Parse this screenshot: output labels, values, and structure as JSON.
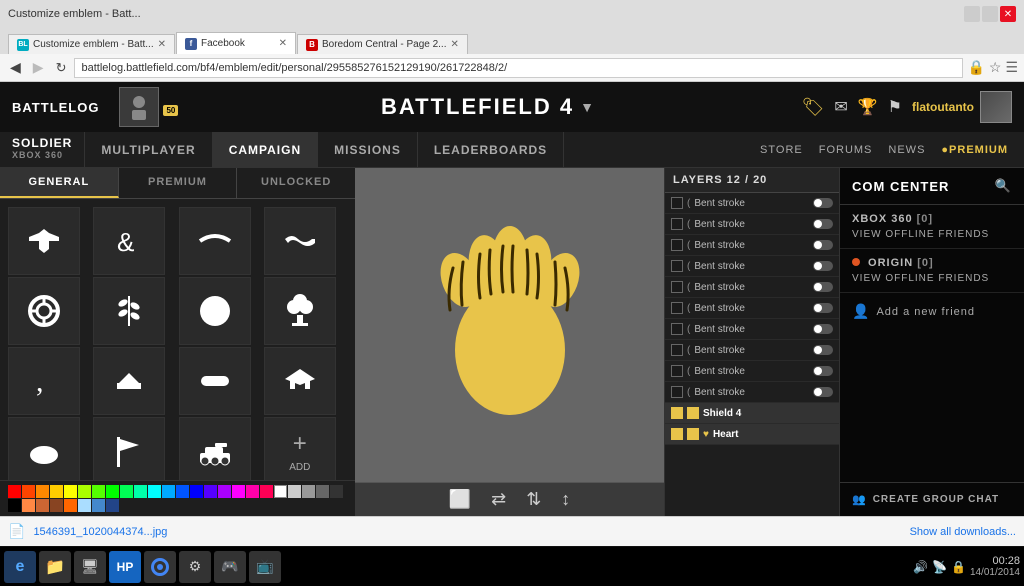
{
  "browser": {
    "tabs": [
      {
        "id": "bl",
        "label": "Customize emblem - Batt...",
        "icon": "BL",
        "active": false
      },
      {
        "id": "fb",
        "label": "Facebook",
        "icon": "f",
        "active": true
      },
      {
        "id": "bc",
        "label": "Boredom Central - Page 2...",
        "icon": "B",
        "active": false
      }
    ],
    "address": "battlelog.battlefield.com/bf4/emblem/edit/personal/295585276152129190/261722848/2/"
  },
  "app": {
    "logo": "BATTLELOG",
    "game_title": "BATTLEFIELD 4",
    "username": "flatoutanto"
  },
  "subnav": {
    "items": [
      {
        "id": "soldier",
        "label": "SOLDIER",
        "platform": "XBOX 360"
      },
      {
        "id": "multiplayer",
        "label": "MULTIPLAYER"
      },
      {
        "id": "campaign",
        "label": "CAMPAIGN"
      },
      {
        "id": "missions",
        "label": "MISSIONS"
      },
      {
        "id": "leaderboards",
        "label": "LEADERBOARDS"
      }
    ],
    "right_items": [
      {
        "id": "store",
        "label": "STORE"
      },
      {
        "id": "forums",
        "label": "FORUMS"
      },
      {
        "id": "news",
        "label": "NEWS"
      },
      {
        "id": "premium",
        "label": "PREMIUM"
      }
    ]
  },
  "shapes_tabs": [
    {
      "id": "general",
      "label": "GENERAL",
      "active": true
    },
    {
      "id": "premium",
      "label": "PREMIUM"
    },
    {
      "id": "unlocked",
      "label": "UNLOCKED"
    }
  ],
  "layers": {
    "header": "LAYERS 12 / 20",
    "items": [
      {
        "name": "Bent stroke",
        "color": "#555",
        "active": false,
        "toggle": true
      },
      {
        "name": "Bent stroke",
        "color": "#555",
        "active": false,
        "toggle": true
      },
      {
        "name": "Bent stroke",
        "color": "#555",
        "active": false,
        "toggle": true
      },
      {
        "name": "Bent stroke",
        "color": "#555",
        "active": false,
        "toggle": true
      },
      {
        "name": "Bent stroke",
        "color": "#555",
        "active": false,
        "toggle": true
      },
      {
        "name": "Bent stroke",
        "color": "#555",
        "active": false,
        "toggle": true
      },
      {
        "name": "Bent stroke",
        "color": "#555",
        "active": false,
        "toggle": true
      },
      {
        "name": "Bent stroke",
        "color": "#555",
        "active": false,
        "toggle": true
      },
      {
        "name": "Bent stroke",
        "color": "#555",
        "active": false,
        "toggle": true
      },
      {
        "name": "Bent stroke",
        "color": "#555",
        "active": false,
        "toggle": true
      },
      {
        "name": "Shield 4",
        "color": "#e8c44a",
        "active": true,
        "toggle": false
      },
      {
        "name": "Heart",
        "color": "#e8c44a",
        "active": true,
        "toggle": false
      }
    ]
  },
  "com_center": {
    "title": "COM CENTER",
    "platforms": [
      {
        "name": "XBOX 360",
        "count": "[0]",
        "has_indicator": false
      },
      {
        "name": "VIEW OFFLINE FRIENDS",
        "count": "",
        "is_link": true
      },
      {
        "name": "ORIGIN",
        "count": "[0]",
        "has_indicator": true
      },
      {
        "name": "VIEW OFFLINE FRIENDS",
        "count": "",
        "is_link": true
      }
    ],
    "add_friend": "Add a new friend",
    "create_group": "CREATE GROUP CHAT"
  },
  "download_bar": {
    "filename": "1546391_1020044374...jpg",
    "action": "Show all downloads..."
  },
  "taskbar": {
    "time": "00:28",
    "date": "14/01/2014"
  },
  "palette_colors": [
    "#ff0000",
    "#ff4400",
    "#ff8800",
    "#ffcc00",
    "#ffff00",
    "#ccff00",
    "#88ff00",
    "#44ff00",
    "#00ff00",
    "#00ff44",
    "#00ff88",
    "#00ffcc",
    "#00ffff",
    "#00ccff",
    "#0088ff",
    "#0044ff",
    "#0000ff",
    "#4400ff",
    "#8800ff",
    "#cc00ff",
    "#ff00ff",
    "#ff00cc",
    "#ff0088",
    "#ff0044",
    "#ff0000",
    "#ffffff",
    "#cccccc",
    "#999999",
    "#666666",
    "#333333",
    "#000000",
    "#884400",
    "#cc6600",
    "#ffaa44",
    "#ffddaa",
    "#aaddff",
    "#4488cc",
    "#224488",
    "#002244",
    "#001122"
  ]
}
